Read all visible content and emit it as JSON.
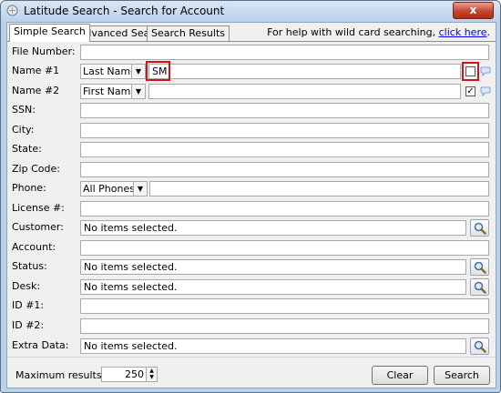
{
  "window": {
    "title": "Latitude Search - Search for Account",
    "close_label": "x"
  },
  "tabs": [
    {
      "label": "Simple Search",
      "active": true
    },
    {
      "label": "Advanced Search",
      "active": false
    },
    {
      "label": "Search Results",
      "active": false
    }
  ],
  "help": {
    "text": "For help with wild card searching, ",
    "link": "click here",
    "suffix": "."
  },
  "fields": {
    "file_number": {
      "label": "File Number:",
      "value": ""
    },
    "name1": {
      "label": "Name #1",
      "type": "Last Name",
      "value": "SM",
      "checked": false
    },
    "name2": {
      "label": "Name #2",
      "type": "First Name",
      "value": "",
      "checked": true
    },
    "ssn": {
      "label": "SSN:",
      "value": ""
    },
    "city": {
      "label": "City:",
      "value": ""
    },
    "state": {
      "label": "State:",
      "value": ""
    },
    "zip": {
      "label": "Zip Code:",
      "value": ""
    },
    "phone": {
      "label": "Phone:",
      "type": "All Phones",
      "value": ""
    },
    "license": {
      "label": "License #:",
      "value": ""
    },
    "customer": {
      "label": "Customer:",
      "value": "No items selected."
    },
    "account": {
      "label": "Account:",
      "value": ""
    },
    "status": {
      "label": "Status:",
      "value": "No items selected."
    },
    "desk": {
      "label": "Desk:",
      "value": "No items selected."
    },
    "id1": {
      "label": "ID #1:",
      "value": ""
    },
    "id2": {
      "label": "ID #2:",
      "value": ""
    },
    "extra": {
      "label": "Extra Data:",
      "value": "No items selected."
    }
  },
  "footer": {
    "max_label": "Maximum results:",
    "max_value": "250",
    "clear_label": "Clear",
    "search_label": "Search"
  },
  "colors": {
    "highlight": "#d0141a",
    "link": "#0000ee"
  },
  "icons": {
    "lookup": "magnifier-icon",
    "comment": "speech-bubble-icon",
    "app": "latitude-app-icon"
  }
}
